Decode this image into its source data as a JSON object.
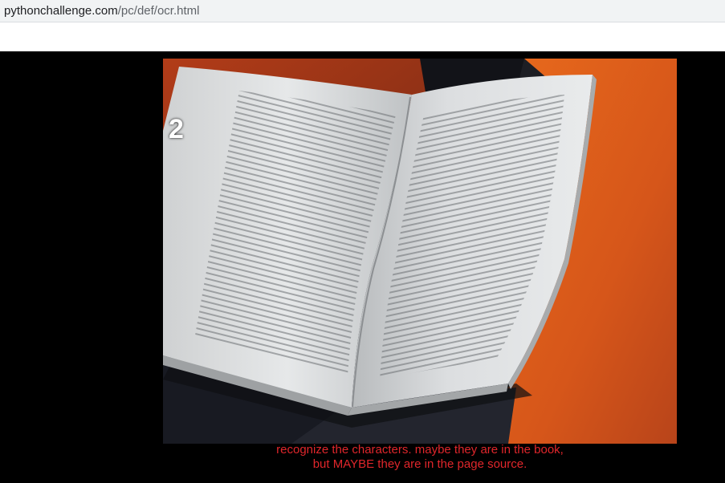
{
  "browser": {
    "url_host": "pythonchallenge.com",
    "url_path": "/pc/def/ocr.html"
  },
  "page": {
    "level_number": "2",
    "caption_line1": "recognize the characters. maybe they are in the book,",
    "caption_line2": "but MAYBE they are in the page source."
  }
}
